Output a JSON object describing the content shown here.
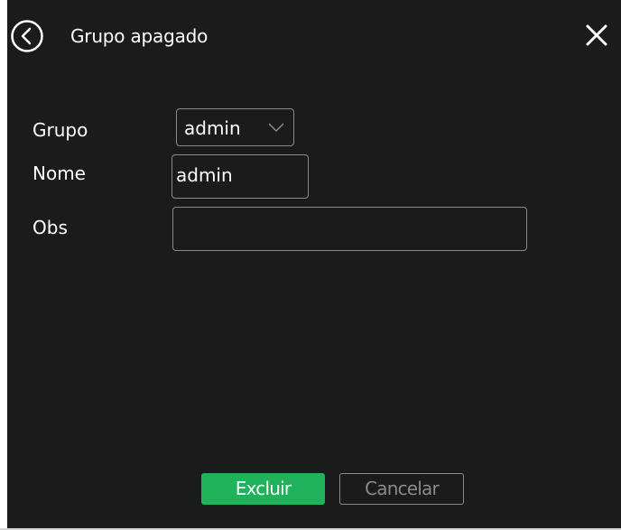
{
  "dialog": {
    "title": "Grupo apagado",
    "back_icon": "circle-chevron-left-icon",
    "close_icon": "close-icon"
  },
  "form": {
    "grupo_label": "Grupo",
    "grupo_value": "admin",
    "grupo_dropdown_icon": "chevron-down-icon",
    "nome_label": "Nome",
    "nome_value": "admin",
    "obs_label": "Obs",
    "obs_value": ""
  },
  "buttons": {
    "delete_label": "Excluir",
    "cancel_label": "Cancelar"
  },
  "colors": {
    "background": "#1b1b1b",
    "accent_green": "#1fb25a",
    "border_gray": "#8a8a8a",
    "text": "#ffffff"
  }
}
